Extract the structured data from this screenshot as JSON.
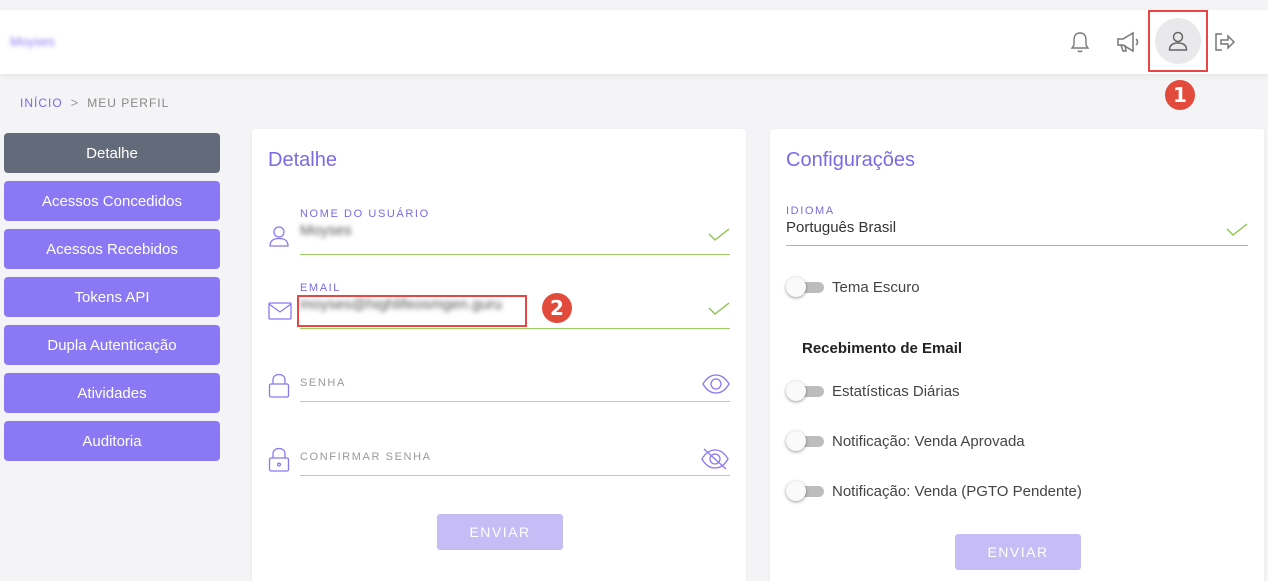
{
  "header": {
    "brand": "Moyses",
    "icons": [
      "bell-icon",
      "megaphone-icon",
      "user-icon",
      "logout-icon"
    ]
  },
  "callouts": {
    "one": "1",
    "two": "2"
  },
  "breadcrumb": {
    "home": "INÍCIO",
    "separator": ">",
    "current": "MEU PERFIL"
  },
  "sidebar": {
    "items": [
      {
        "label": "Detalhe",
        "active": true
      },
      {
        "label": "Acessos Concedidos",
        "active": false
      },
      {
        "label": "Acessos Recebidos",
        "active": false
      },
      {
        "label": "Tokens API",
        "active": false
      },
      {
        "label": "Dupla Autenticação",
        "active": false
      },
      {
        "label": "Atividades",
        "active": false
      },
      {
        "label": "Auditoria",
        "active": false
      }
    ]
  },
  "detail": {
    "title": "Detalhe",
    "username_label": "NOME DO USUÁRIO",
    "username_value": "Moyses",
    "email_label": "EMAIL",
    "email_value": "moyses@highlifeosmgen.guru",
    "password_label": "SENHA",
    "confirm_password_label": "CONFIRMAR SENHA",
    "submit_label": "ENVIAR"
  },
  "settings": {
    "title": "Configurações",
    "language_label": "IDIOMA",
    "language_value": "Português Brasil",
    "dark_theme_label": "Tema Escuro",
    "email_section_title": "Recebimento de Email",
    "toggles": [
      {
        "label": "Estatísticas Diárias",
        "on": false
      },
      {
        "label": "Notificação: Venda Aprovada",
        "on": false
      },
      {
        "label": "Notificação: Venda (PGTO Pendente)",
        "on": false
      }
    ],
    "submit_label": "ENVIAR"
  },
  "colors": {
    "accent": "#7b6ae8",
    "sidebar_button": "#8b78f4",
    "sidebar_active": "#636a79",
    "valid_line": "#9ccc65",
    "empty_line": "#f0c060",
    "callout": "#e24a3c"
  }
}
